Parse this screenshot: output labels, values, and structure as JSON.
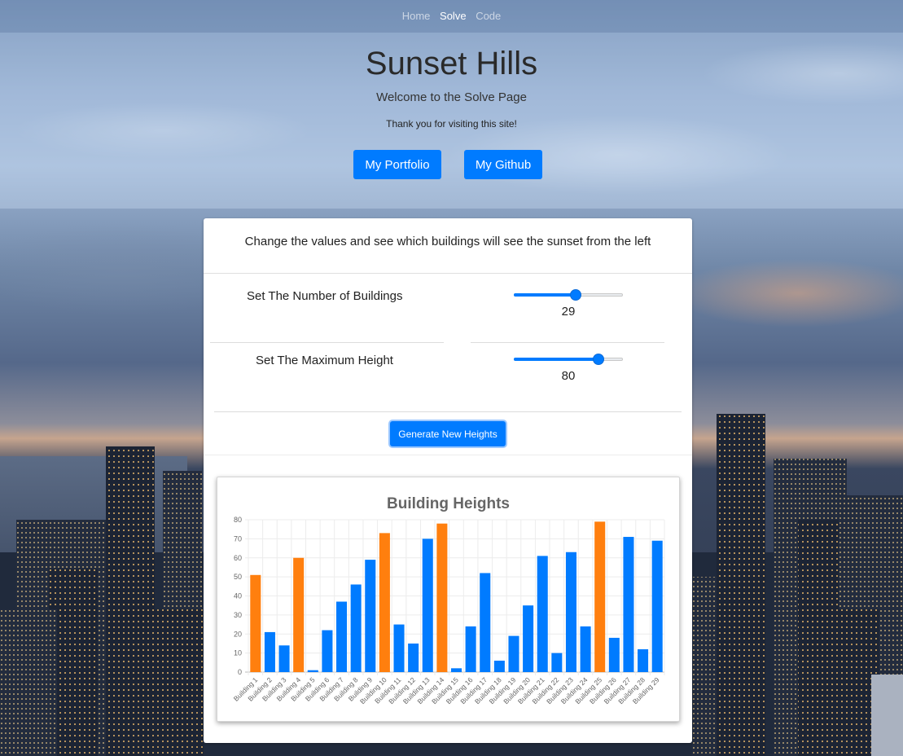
{
  "nav": {
    "items": [
      "Home",
      "Solve",
      "Code"
    ],
    "active": "Solve"
  },
  "hero": {
    "title": "Sunset Hills",
    "subtitle": "Welcome to the Solve Page",
    "thanks": "Thank you for visiting this site!",
    "portfolio_label": "My Portfolio",
    "github_label": "My Github"
  },
  "card": {
    "header": "Change the values and see which buildings will see the sunset from the left",
    "buildings_label": "Set The Number of Buildings",
    "buildings_value": "29",
    "buildings_fraction": 0.56,
    "height_label": "Set The Maximum Height",
    "height_value": "80",
    "height_fraction": 0.77,
    "generate_label": "Generate New Heights"
  },
  "colors": {
    "accent": "#007bff",
    "sunset": "#ff7f0e",
    "blocked": "#007bff"
  },
  "chart_data": {
    "type": "bar",
    "title": "Building Heights",
    "ylim": [
      0,
      80
    ],
    "yticks": [
      0,
      10,
      20,
      30,
      40,
      50,
      60,
      70,
      80
    ],
    "grid": true,
    "categories": [
      "Building 1",
      "Building 2",
      "Building 3",
      "Building 4",
      "Building 5",
      "Building 6",
      "Building 7",
      "Building 8",
      "Building 9",
      "Building 10",
      "Building 11",
      "Building 12",
      "Building 13",
      "Building 14",
      "Building 15",
      "Building 16",
      "Building 17",
      "Building 18",
      "Building 19",
      "Building 20",
      "Building 21",
      "Building 22",
      "Building 23",
      "Building 24",
      "Building 25",
      "Building 26",
      "Building 27",
      "Building 28",
      "Building 29"
    ],
    "values": [
      51,
      21,
      14,
      60,
      1,
      22,
      37,
      46,
      59,
      73,
      25,
      15,
      70,
      78,
      2,
      24,
      52,
      6,
      19,
      35,
      61,
      10,
      63,
      24,
      79,
      18,
      71,
      12,
      69
    ],
    "sees_sunset": [
      true,
      false,
      false,
      true,
      false,
      false,
      false,
      false,
      false,
      true,
      false,
      false,
      false,
      true,
      false,
      false,
      false,
      false,
      false,
      false,
      false,
      false,
      false,
      false,
      true,
      false,
      false,
      false,
      false
    ]
  }
}
